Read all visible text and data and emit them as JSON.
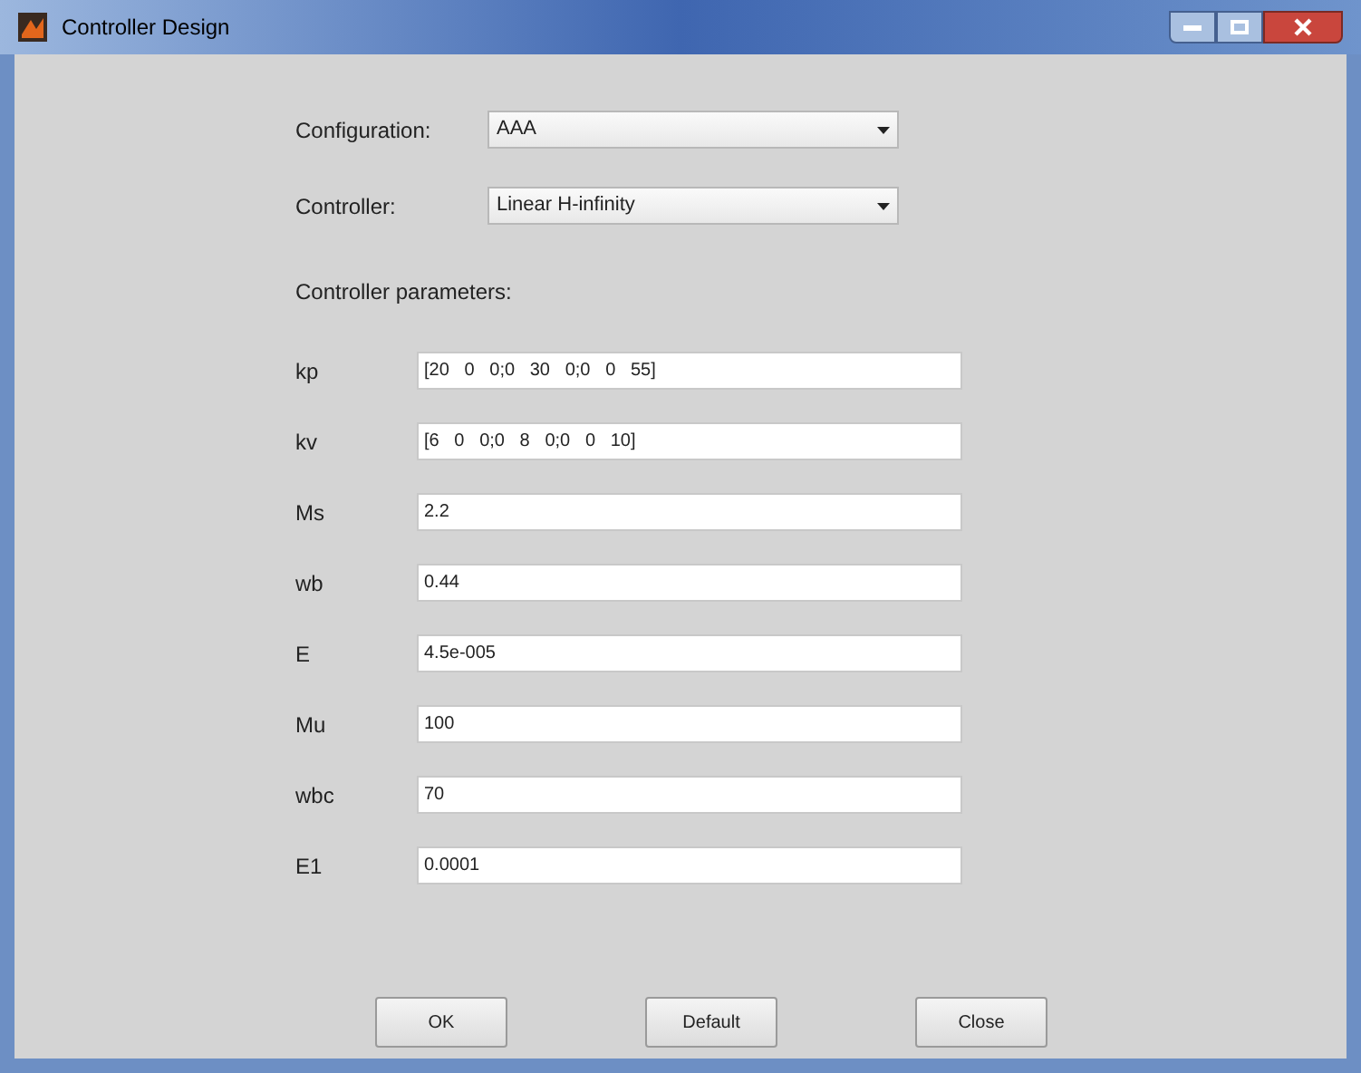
{
  "window": {
    "title": "Controller Design"
  },
  "selectors": [
    {
      "label": "Configuration:",
      "value": "AAA"
    },
    {
      "label": "Controller:",
      "value": "Linear H-infinity"
    }
  ],
  "parameters_heading": "Controller parameters:",
  "parameters": [
    {
      "label": "kp",
      "value": "[20   0   0;0   30   0;0   0   55]"
    },
    {
      "label": "kv",
      "value": "[6   0   0;0   8   0;0   0   10]"
    },
    {
      "label": "Ms",
      "value": "2.2"
    },
    {
      "label": "wb",
      "value": "0.44"
    },
    {
      "label": "E",
      "value": "4.5e-005"
    },
    {
      "label": "Mu",
      "value": "100"
    },
    {
      "label": "wbc",
      "value": "70"
    },
    {
      "label": "E1",
      "value": "0.0001"
    }
  ],
  "buttons": [
    "OK",
    "Default",
    "Close"
  ]
}
